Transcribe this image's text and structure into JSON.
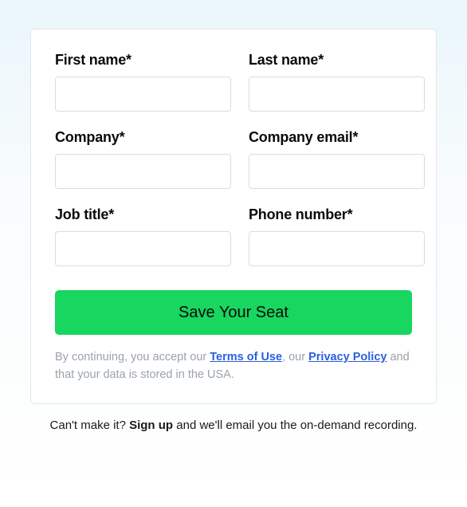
{
  "form": {
    "fields": {
      "first_name": {
        "label": "First name*",
        "value": ""
      },
      "last_name": {
        "label": "Last name*",
        "value": ""
      },
      "company": {
        "label": "Company*",
        "value": ""
      },
      "company_email": {
        "label": "Company email*",
        "value": ""
      },
      "job_title": {
        "label": "Job title*",
        "value": ""
      },
      "phone_number": {
        "label": "Phone number*",
        "value": ""
      }
    },
    "submit_label": "Save Your Seat",
    "disclaimer": {
      "prefix": "By continuing, you accept our ",
      "terms_link": "Terms of Use",
      "mid1": ", our ",
      "privacy_link": "Privacy Policy",
      "suffix": " and that your data is stored in the USA."
    }
  },
  "footer_note": {
    "prefix": "Can't make it? ",
    "signup": "Sign up",
    "suffix": " and we'll email you the on-demand recording."
  }
}
